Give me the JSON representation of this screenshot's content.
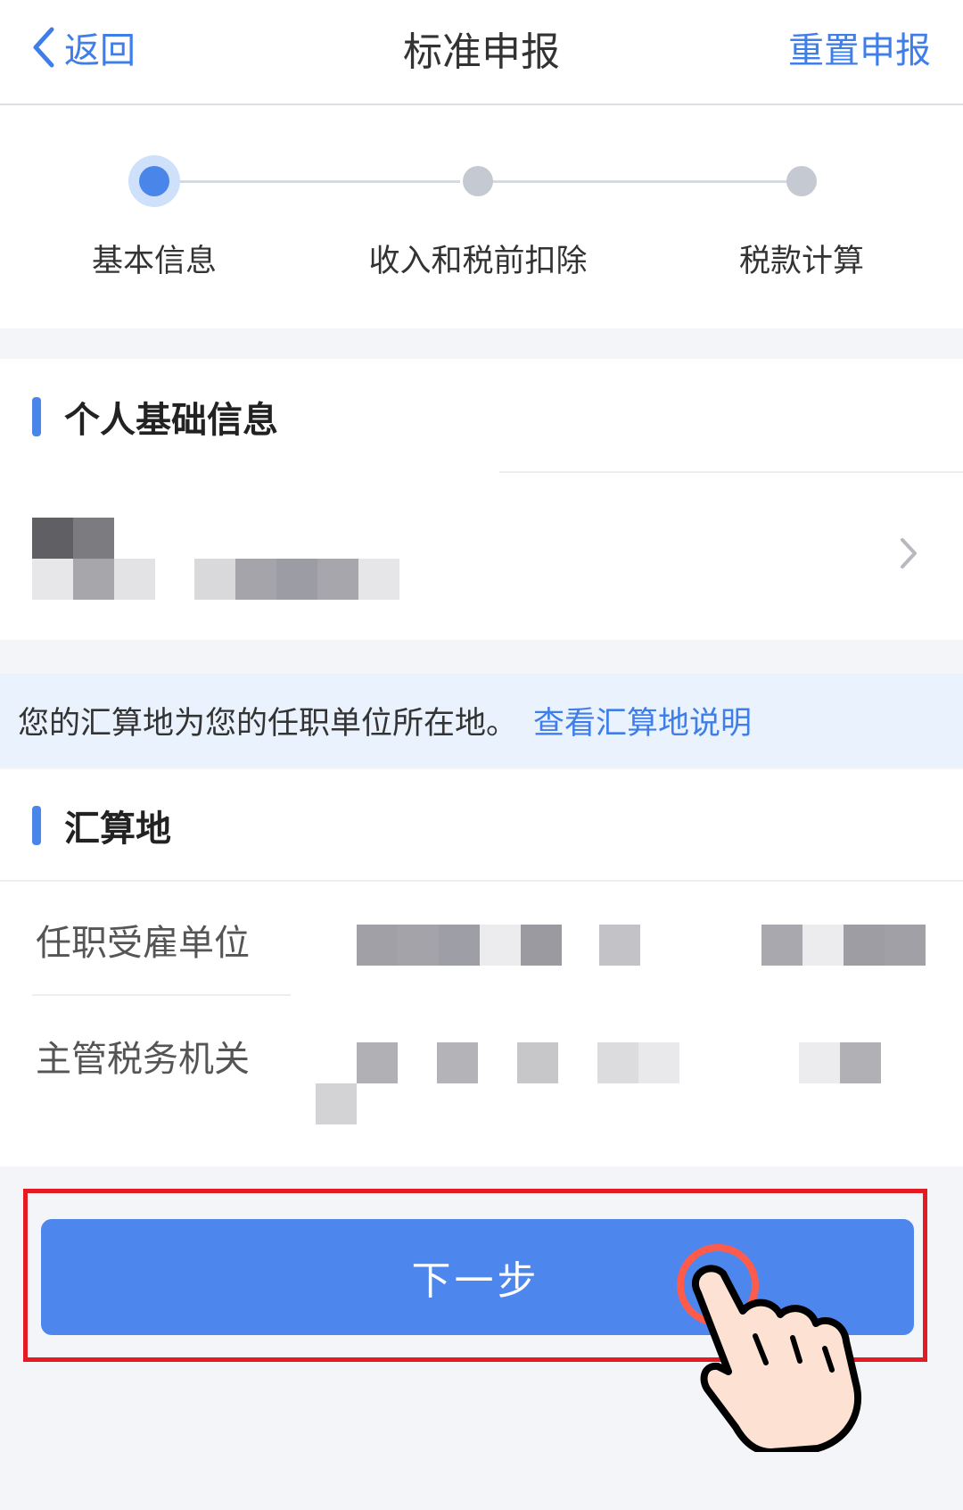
{
  "navbar": {
    "back_label": "返回",
    "title": "标准申报",
    "reset_label": "重置申报"
  },
  "steps": [
    {
      "label": "基本信息",
      "state": "active"
    },
    {
      "label": "收入和税前扣除",
      "state": "pending"
    },
    {
      "label": "税款计算",
      "state": "pending"
    }
  ],
  "personal_info": {
    "section_title": "个人基础信息"
  },
  "notice": {
    "text": "您的汇算地为您的任职单位所在地。",
    "link": "查看汇算地说明"
  },
  "settlement": {
    "section_title": "汇算地",
    "rows": [
      {
        "label": "任职受雇单位"
      },
      {
        "label": "主管税务机关"
      }
    ]
  },
  "action": {
    "next_label": "下一步"
  },
  "colors": {
    "accent": "#4a86ea",
    "button": "#4d87ee",
    "highlight_border": "#e31b23",
    "notice_bg": "#e9f2fd"
  },
  "icons": {
    "back": "chevron-left-icon",
    "row_arrow": "chevron-right-icon",
    "pointer": "hand-pointer-icon"
  }
}
